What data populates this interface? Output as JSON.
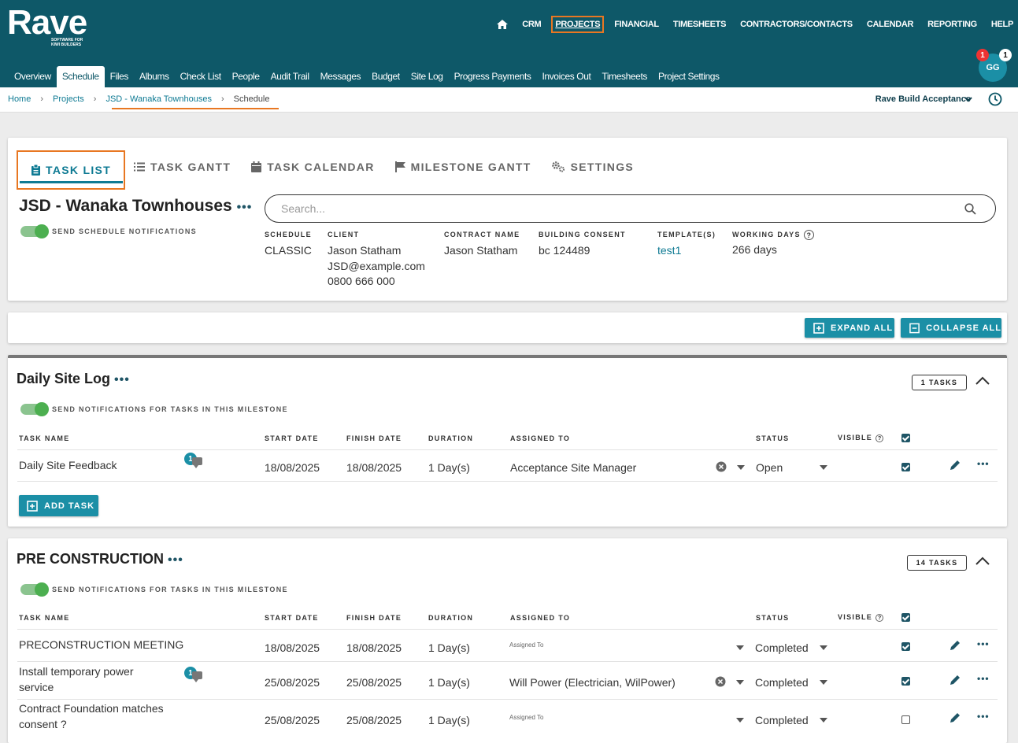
{
  "brand": {
    "name": "Rave",
    "tagline1": "SOFTWARE FOR",
    "tagline2": "KIWI BUILDERS"
  },
  "main_nav": [
    "CRM",
    "PROJECTS",
    "FINANCIAL",
    "TIMESHEETS",
    "CONTRACTORS/CONTACTS",
    "CALENDAR",
    "REPORTING",
    "HELP"
  ],
  "main_nav_active": "PROJECTS",
  "sub_nav": [
    "Overview",
    "Schedule",
    "Files",
    "Albums",
    "Check List",
    "People",
    "Audit Trail",
    "Messages",
    "Budget",
    "Site Log",
    "Progress Payments",
    "Invoices Out",
    "Timesheets",
    "Project Settings"
  ],
  "sub_nav_active": "Schedule",
  "user": {
    "initials": "GG",
    "notif_red": "1",
    "notif_white": "1"
  },
  "breadcrumb": {
    "home": "Home",
    "projects": "Projects",
    "project": "JSD - Wanaka Townhouses",
    "current": "Schedule",
    "separator": "›"
  },
  "account": "Rave Build Acceptance",
  "view_tabs": {
    "task_list": "TASK LIST",
    "task_gantt": "TASK GANTT",
    "task_calendar": "TASK CALENDAR",
    "milestone_gantt": "MILESTONE GANTT",
    "settings": "SETTINGS"
  },
  "project": {
    "title": "JSD - Wanaka Townhouses",
    "send_notifications_label": "SEND SCHEDULE NOTIFICATIONS",
    "search_placeholder": "Search...",
    "meta": {
      "schedule_label": "SCHEDULE",
      "schedule": "CLASSIC",
      "client_label": "CLIENT",
      "client_name": "Jason Statham",
      "client_email": "JSD@example.com",
      "client_phone": "0800 666 000",
      "contract_label": "CONTRACT NAME",
      "contract": "Jason Statham",
      "consent_label": "BUILDING CONSENT",
      "consent": "bc 124489",
      "template_label": "TEMPLATE(S)",
      "template": "test1",
      "working_days_label": "WORKING DAYS",
      "working_days": "266 days"
    }
  },
  "actions": {
    "expand_all": "EXPAND ALL",
    "collapse_all": "COLLAPSE ALL"
  },
  "columns": {
    "task_name": "TASK NAME",
    "start_date": "START DATE",
    "finish_date": "FINISH DATE",
    "duration": "DURATION",
    "assigned_to": "ASSIGNED TO",
    "status": "STATUS",
    "visible": "VISIBLE"
  },
  "milestones": [
    {
      "title": "Daily Site Log",
      "count": "1 TASKS",
      "notify_label": "SEND NOTIFICATIONS FOR TASKS IN THIS MILESTONE",
      "add_task": "ADD TASK",
      "tasks": [
        {
          "name": "Daily Site Feedback",
          "comments": "1",
          "start": "18/08/2025",
          "finish": "18/08/2025",
          "duration": "1 Day(s)",
          "assigned": "Acceptance Site Manager",
          "status": "Open",
          "visible": true
        }
      ]
    },
    {
      "title": "PRE CONSTRUCTION",
      "count": "14 TASKS",
      "notify_label": "SEND NOTIFICATIONS FOR TASKS IN THIS MILESTONE",
      "tasks": [
        {
          "name": "PRECONSTRUCTION MEETING",
          "start": "18/08/2025",
          "finish": "18/08/2025",
          "duration": "1 Day(s)",
          "assigned_placeholder": "Assigned To",
          "status": "Completed",
          "visible": true
        },
        {
          "name": "Install temporary power service",
          "comments": "1",
          "start": "25/08/2025",
          "finish": "25/08/2025",
          "duration": "1 Day(s)",
          "assigned": "Will Power (Electrician, WilPower)",
          "status": "Completed",
          "visible": true
        },
        {
          "name": "Contract Foundation matches consent ?",
          "start": "25/08/2025",
          "finish": "25/08/2025",
          "duration": "1 Day(s)",
          "assigned_placeholder": "Assigned To",
          "status": "Completed",
          "visible": false
        }
      ]
    }
  ],
  "colors": {
    "header": "#0e5868",
    "accent": "#1b8fa6",
    "highlight": "#e87722",
    "toggle": "#4caf50"
  }
}
